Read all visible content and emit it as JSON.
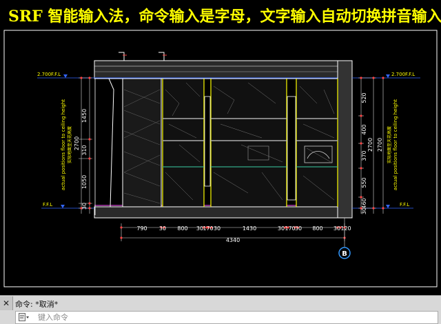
{
  "banner": {
    "text": "SRF 智能输入法，命令输入是字母，文字输入自动切换拼音输入法",
    "color": "#ffff00"
  },
  "drawing": {
    "levels": {
      "top_left": "2.700F.F.L",
      "top_right": "2.700F.F.L",
      "bottom_left": "F.F.L",
      "bottom_right": "F.F.L"
    },
    "left_vertical_dims": [
      "1450",
      "310",
      "1050",
      "30"
    ],
    "left_total": "2700",
    "left_note_en": "actual positions floor to ceiling height",
    "left_note_cn": "实际地面至天花高度",
    "right_vertical_dims": [
      "520",
      "400",
      "370",
      "550",
      "460",
      "30"
    ],
    "right_total_a": "2700",
    "right_total_b": "2700",
    "right_note_en": "actual positions floor to ceiling height",
    "right_note_cn": "实际地面至天花高度",
    "horizontal_dims": [
      "790",
      "30",
      "800",
      "30",
      "170",
      "30",
      "1430",
      "30",
      "170",
      "30",
      "800",
      "30",
      "120"
    ],
    "horizontal_total": "4340",
    "grid_marker": "B"
  },
  "command": {
    "history": "命令: *取消*",
    "placeholder": "键入命令",
    "close_icon": "close-icon",
    "cmd_icon": "command-line-icon"
  }
}
